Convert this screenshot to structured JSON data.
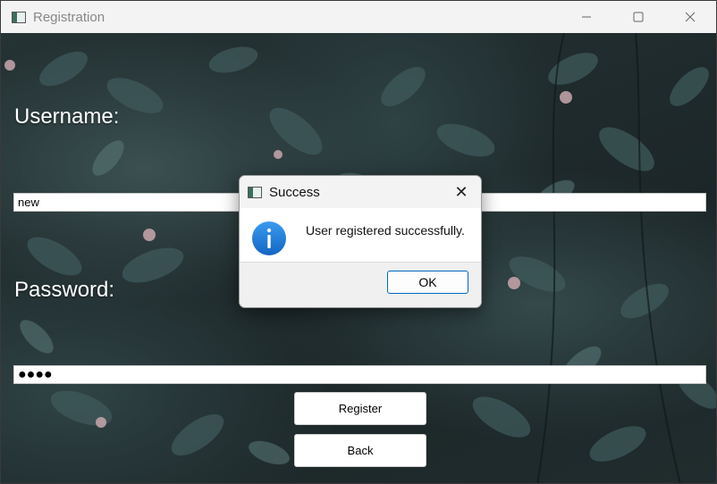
{
  "window": {
    "title": "Registration",
    "controls": {
      "minimize_icon": "minimize-icon",
      "maximize_icon": "maximize-icon",
      "close_icon": "close-icon"
    }
  },
  "form": {
    "username_label": "Username:",
    "username_value": "new",
    "password_label": "Password:",
    "password_masked": "●●●●",
    "register_label": "Register",
    "back_label": "Back"
  },
  "dialog": {
    "title": "Success",
    "message": "User registered successfully.",
    "ok_label": "OK",
    "icon": "info-icon",
    "close_glyph": "✕"
  },
  "colors": {
    "accent": "#0067c0",
    "info_icon": "#1e7fd8",
    "background": "#1f2a2c"
  }
}
